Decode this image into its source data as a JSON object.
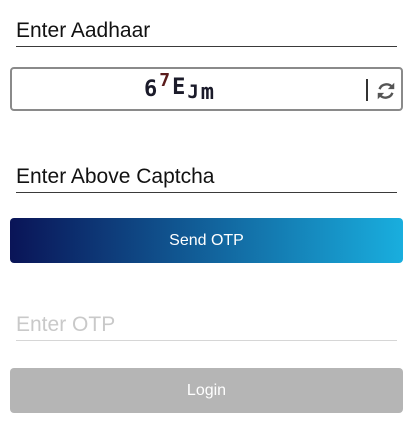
{
  "form": {
    "aadhaar_placeholder": "Enter Aadhaar",
    "captcha": {
      "chars": [
        "6",
        "7",
        "E",
        "J",
        "m"
      ],
      "refresh_icon": "refresh-icon"
    },
    "captcha_placeholder": "Enter Above Captcha",
    "send_otp_label": "Send OTP",
    "otp_placeholder": "Enter OTP",
    "login_label": "Login"
  },
  "colors": {
    "gradient_start": "#0a1457",
    "gradient_end": "#19aede",
    "login_disabled": "#b5b5b5",
    "text": "#111111",
    "placeholder_disabled": "#c9c9c9"
  }
}
